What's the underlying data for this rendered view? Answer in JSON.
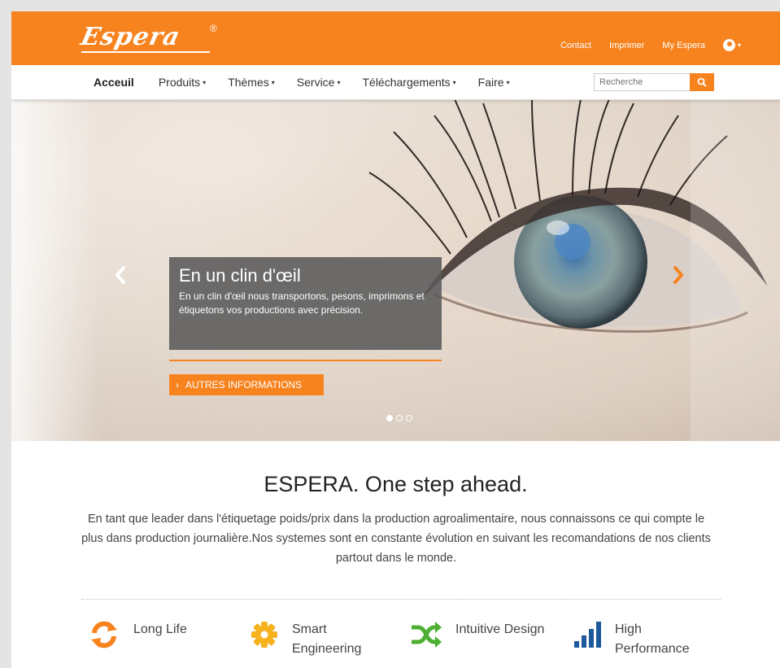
{
  "brand": {
    "logo_text": "Espera",
    "registered": "®"
  },
  "top_links": [
    "Contact",
    "Imprimer",
    "My Espera"
  ],
  "nav": {
    "items": [
      {
        "label": "Acceuil",
        "dropdown": ""
      },
      {
        "label": "Produits",
        "dropdown": "▾"
      },
      {
        "label": "Thèmes",
        "dropdown": "▾"
      },
      {
        "label": "Service",
        "dropdown": "▾"
      },
      {
        "label": "Téléchargements",
        "dropdown": "▾"
      },
      {
        "label": "Faire",
        "dropdown": "▾"
      }
    ],
    "search_placeholder": "Recherche"
  },
  "hero": {
    "title": "En un clin d'œil",
    "text": "En un clin d'œil nous transportons, pesons, imprimons et étiquetons vos productions avec précision.",
    "button_label": "AUTRES INFORMATIONS",
    "slides": 3,
    "active_slide": 1
  },
  "intro": {
    "title": "ESPERA. One step ahead.",
    "text": "En tant que leader dans l'étiquetage poids/prix dans la production agroalimentaire, nous connaissons ce qui compte le plus dans production journalière.Nos systemes sont en constante évolution en suivant les recomandations de nos clients partout dans le monde."
  },
  "features": [
    {
      "label": "Long Life",
      "icon": "refresh-icon"
    },
    {
      "label": "Smart Engineering",
      "icon": "gear-icon"
    },
    {
      "label": "Intuitive Design",
      "icon": "shuffle-icon"
    },
    {
      "label": "High Performance",
      "icon": "signal-bars-icon"
    }
  ],
  "colors": {
    "accent": "#f7831f",
    "caption_bg": "#5a5a5a",
    "text": "#444444"
  }
}
